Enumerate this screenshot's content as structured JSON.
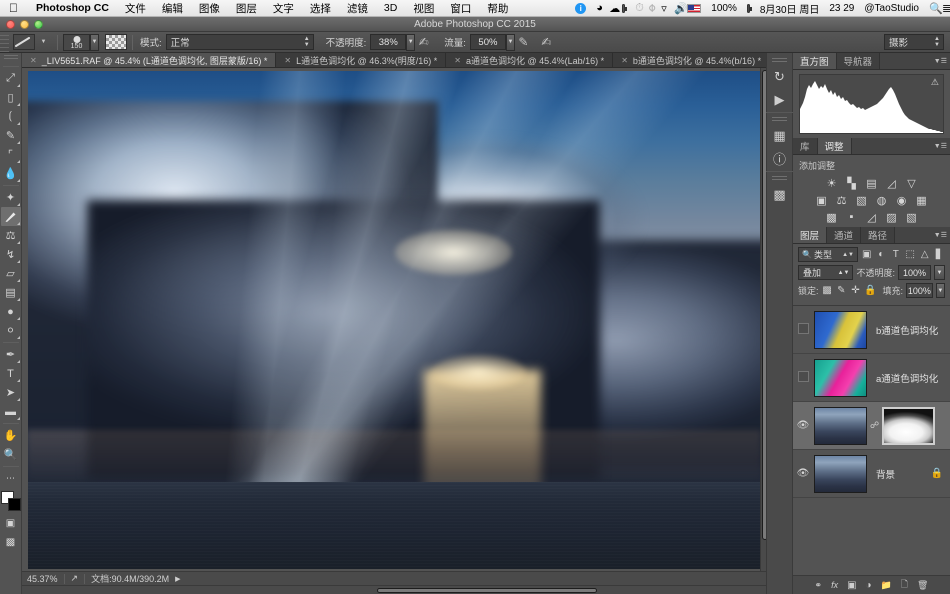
{
  "macmenu": {
    "apple_icon": "apple-icon",
    "app_name": "Photoshop CC",
    "items": [
      "文件",
      "编辑",
      "图像",
      "图层",
      "文字",
      "选择",
      "滤镜",
      "3D",
      "视图",
      "窗口",
      "帮助"
    ],
    "status": {
      "info_icon": "info-icon",
      "dropbox_icon": "dropbox-icon",
      "cloud_icon": "cloud-icon",
      "battery_widget_icon": "battery-widget-icon",
      "clock_icon": "clock-icon",
      "bluetooth_icon": "bluetooth-icon",
      "wifi_icon": "wifi-icon",
      "volume_icon": "volume-icon",
      "flag_icon": "us-flag-icon",
      "battery_percent": "100%",
      "battery_icon": "battery-icon",
      "date": "8月30日 周日",
      "time": "23 29",
      "user": "@TaoStudio",
      "search_icon": "search-icon",
      "notification_icon": "notification-center-icon"
    }
  },
  "titlebar": {
    "title": "Adobe Photoshop CC 2015"
  },
  "optionsbar": {
    "brush_preset_icon": "brush-preset-icon",
    "brush_size": "150",
    "brush_panel_icon": "brush-panel-icon",
    "mode_label": "模式:",
    "mode_value": "正常",
    "opacity_label": "不透明度:",
    "opacity_value": "38%",
    "opacity_pressure_icon": "opacity-pressure-icon",
    "flow_label": "流量:",
    "flow_value": "50%",
    "airbrush_icon": "airbrush-icon",
    "smoothing_icon": "smoothing-pressure-icon",
    "workspace_value": "摄影"
  },
  "tabs": [
    {
      "label": "_LIV5651.RAF @ 45.4% (L通道色调均化, 图层蒙版/16) *",
      "active": true,
      "close_icon": "close-icon"
    },
    {
      "label": "L通道色调均化 @ 46.3%(明度/16) *",
      "active": false,
      "close_icon": "close-icon"
    },
    {
      "label": "a通道色调均化 @ 45.4%(Lab/16) *",
      "active": false,
      "close_icon": "close-icon"
    },
    {
      "label": "b通道色调均化 @ 45.4%(b/16) *",
      "active": false,
      "close_icon": "close-icon"
    }
  ],
  "toolbar": {
    "tools": [
      {
        "name": "move-tool",
        "glyph": "⊹",
        "selected": false
      },
      {
        "name": "marquee-tool",
        "glyph": "▭",
        "selected": false
      },
      {
        "name": "lasso-tool",
        "glyph": "◠",
        "selected": false
      },
      {
        "name": "quick-selection-tool",
        "glyph": "✎",
        "selected": false
      },
      {
        "name": "crop-tool",
        "glyph": "⌗",
        "selected": false
      },
      {
        "name": "eyedropper-tool",
        "glyph": "⚲",
        "selected": false
      },
      {
        "name": "spot-healing-brush-tool",
        "glyph": "✦",
        "selected": false
      },
      {
        "name": "brush-tool",
        "glyph": "🖌",
        "selected": true
      },
      {
        "name": "clone-stamp-tool",
        "glyph": "⚒",
        "selected": false
      },
      {
        "name": "history-brush-tool",
        "glyph": "↯",
        "selected": false
      },
      {
        "name": "eraser-tool",
        "glyph": "▱",
        "selected": false
      },
      {
        "name": "gradient-tool",
        "glyph": "▤",
        "selected": false
      },
      {
        "name": "blur-tool",
        "glyph": "◗",
        "selected": false
      },
      {
        "name": "dodge-tool",
        "glyph": "●",
        "selected": false
      },
      {
        "name": "pen-tool",
        "glyph": "✒",
        "selected": false
      },
      {
        "name": "type-tool",
        "glyph": "T",
        "selected": false
      },
      {
        "name": "path-selection-tool",
        "glyph": "➤",
        "selected": false
      },
      {
        "name": "rectangle-tool",
        "glyph": "▬",
        "selected": false
      },
      {
        "name": "hand-tool",
        "glyph": "✋",
        "selected": false
      },
      {
        "name": "zoom-tool",
        "glyph": "⚲",
        "selected": false
      }
    ],
    "quickmask_icon": "quick-mask-icon",
    "screenmode_icon": "screen-mode-icon",
    "foreground_color": "#ffffff",
    "background_color": "#000000"
  },
  "statusbar": {
    "zoom": "45.37%",
    "share_icon": "share-icon",
    "doc_info": "文档:90.4M/390.2M",
    "arrow_icon": "play-arrow-icon"
  },
  "dockstrip": {
    "icons": [
      {
        "name": "history-panel-icon",
        "glyph": "↺"
      },
      {
        "name": "actions-panel-icon",
        "glyph": "▶"
      },
      {
        "name": "properties-panel-icon",
        "glyph": "▦"
      },
      {
        "name": "info-panel-icon",
        "glyph": "ⓘ"
      },
      {
        "name": "channels-panel-icon",
        "glyph": "▥"
      }
    ]
  },
  "histogram_panel": {
    "tabs": [
      "直方图",
      "导航器"
    ],
    "active_tab": "直方图",
    "warning_icon": "cached-data-warning-icon",
    "menu_icon": "panel-menu-icon"
  },
  "adjustments_panel": {
    "tabs": [
      "库",
      "调整"
    ],
    "active_tab": "调整",
    "title": "添加调整",
    "row1": [
      {
        "name": "brightness-contrast-icon",
        "glyph": "☀"
      },
      {
        "name": "levels-icon",
        "glyph": "▁▃▅"
      },
      {
        "name": "curves-icon",
        "glyph": "◰"
      },
      {
        "name": "exposure-icon",
        "glyph": "◿"
      },
      {
        "name": "vibrance-icon",
        "glyph": "▽"
      }
    ],
    "row2": [
      {
        "name": "hue-saturation-icon",
        "glyph": "▣"
      },
      {
        "name": "color-balance-icon",
        "glyph": "⚖"
      },
      {
        "name": "black-white-icon",
        "glyph": "◧"
      },
      {
        "name": "photo-filter-icon",
        "glyph": "◍"
      },
      {
        "name": "channel-mixer-icon",
        "glyph": "◉"
      },
      {
        "name": "color-lookup-icon",
        "glyph": "▦"
      }
    ],
    "row3": [
      {
        "name": "invert-icon",
        "glyph": "◩"
      },
      {
        "name": "posterize-icon",
        "glyph": "◪"
      },
      {
        "name": "threshold-icon",
        "glyph": "◿"
      },
      {
        "name": "selective-color-icon",
        "glyph": "▨"
      },
      {
        "name": "gradient-map-icon",
        "glyph": "◧"
      }
    ]
  },
  "layers_panel": {
    "tabs": [
      "图层",
      "通道",
      "路径"
    ],
    "active_tab": "图层",
    "filter_icon": "search-filter-icon",
    "filter_value": "类型",
    "filter_tools": [
      {
        "name": "filter-pixel-icon",
        "glyph": "▣"
      },
      {
        "name": "filter-adjustment-icon",
        "glyph": "◐"
      },
      {
        "name": "filter-type-icon",
        "glyph": "T"
      },
      {
        "name": "filter-shape-icon",
        "glyph": "⬚"
      },
      {
        "name": "filter-smartobject-icon",
        "glyph": "⬓"
      }
    ],
    "filter_toggle_icon": "filter-toggle-icon",
    "blend_mode": "叠加",
    "opacity_label": "不透明度:",
    "opacity_value": "100%",
    "lock_label": "锁定:",
    "lock_icons": [
      {
        "name": "lock-transparent-pixels-icon",
        "glyph": "▩"
      },
      {
        "name": "lock-image-pixels-icon",
        "glyph": "🖌"
      },
      {
        "name": "lock-position-icon",
        "glyph": "✛"
      },
      {
        "name": "lock-all-icon",
        "glyph": "🔒"
      }
    ],
    "fill_label": "填充:",
    "fill_value": "100%",
    "layers": [
      {
        "name": "b通道色调均化",
        "visible": false,
        "selected": false,
        "thumb": "b-channel-thumb",
        "has_mask": false,
        "locked": false
      },
      {
        "name": "a通道色调均化",
        "visible": false,
        "selected": false,
        "thumb": "a-channel-thumb",
        "has_mask": false,
        "locked": false
      },
      {
        "name": "",
        "visible": true,
        "selected": true,
        "thumb": "photo-thumb",
        "has_mask": true,
        "mask_thumb": "layer-mask-thumb",
        "locked": false
      },
      {
        "name": "背景",
        "visible": true,
        "selected": false,
        "thumb": "photo-thumb",
        "has_mask": false,
        "locked": true
      }
    ],
    "footer_icons": [
      {
        "name": "link-layers-icon",
        "glyph": "⛓"
      },
      {
        "name": "layer-style-icon",
        "glyph": "fx"
      },
      {
        "name": "add-layer-mask-icon",
        "glyph": "▣"
      },
      {
        "name": "new-adjustment-layer-icon",
        "glyph": "◑"
      },
      {
        "name": "new-group-icon",
        "glyph": "🗀"
      },
      {
        "name": "new-layer-icon",
        "glyph": "🗋"
      },
      {
        "name": "delete-layer-icon",
        "glyph": "🗑"
      }
    ]
  }
}
